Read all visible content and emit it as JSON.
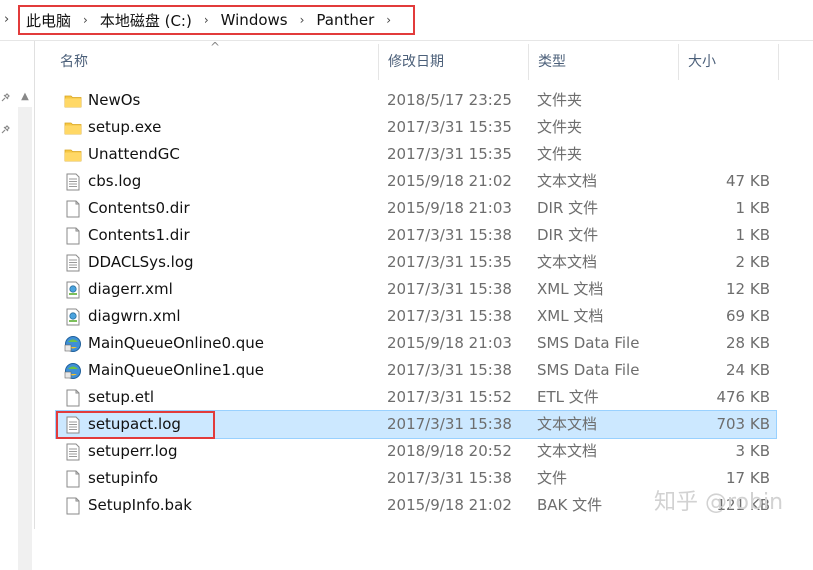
{
  "breadcrumb": {
    "items": [
      "此电脑",
      "本地磁盘 (C:)",
      "Windows",
      "Panther"
    ]
  },
  "columns": {
    "name": "名称",
    "date": "修改日期",
    "type": "类型",
    "size": "大小"
  },
  "files": [
    {
      "name": "NewOs",
      "date": "2018/5/17 23:25",
      "type": "文件夹",
      "size": "",
      "icon": "folder-icon"
    },
    {
      "name": "setup.exe",
      "date": "2017/3/31 15:35",
      "type": "文件夹",
      "size": "",
      "icon": "folder-icon"
    },
    {
      "name": "UnattendGC",
      "date": "2017/3/31 15:35",
      "type": "文件夹",
      "size": "",
      "icon": "folder-icon"
    },
    {
      "name": "cbs.log",
      "date": "2015/9/18 21:02",
      "type": "文本文档",
      "size": "47 KB",
      "icon": "text-file-icon"
    },
    {
      "name": "Contents0.dir",
      "date": "2015/9/18 21:03",
      "type": "DIR 文件",
      "size": "1 KB",
      "icon": "blank-file-icon"
    },
    {
      "name": "Contents1.dir",
      "date": "2017/3/31 15:38",
      "type": "DIR 文件",
      "size": "1 KB",
      "icon": "blank-file-icon"
    },
    {
      "name": "DDACLSys.log",
      "date": "2017/3/31 15:35",
      "type": "文本文档",
      "size": "2 KB",
      "icon": "text-file-icon"
    },
    {
      "name": "diagerr.xml",
      "date": "2017/3/31 15:38",
      "type": "XML 文档",
      "size": "12 KB",
      "icon": "xml-file-icon"
    },
    {
      "name": "diagwrn.xml",
      "date": "2017/3/31 15:38",
      "type": "XML 文档",
      "size": "69 KB",
      "icon": "xml-file-icon"
    },
    {
      "name": "MainQueueOnline0.que",
      "date": "2015/9/18 21:03",
      "type": "SMS Data File",
      "size": "28 KB",
      "icon": "sms-file-icon"
    },
    {
      "name": "MainQueueOnline1.que",
      "date": "2017/3/31 15:38",
      "type": "SMS Data File",
      "size": "24 KB",
      "icon": "sms-file-icon"
    },
    {
      "name": "setup.etl",
      "date": "2017/3/31 15:52",
      "type": "ETL 文件",
      "size": "476 KB",
      "icon": "blank-file-icon"
    },
    {
      "name": "setupact.log",
      "date": "2017/3/31 15:38",
      "type": "文本文档",
      "size": "703 KB",
      "icon": "text-file-icon"
    },
    {
      "name": "setuperr.log",
      "date": "2018/9/18 20:52",
      "type": "文本文档",
      "size": "3 KB",
      "icon": "text-file-icon"
    },
    {
      "name": "setupinfo",
      "date": "2017/3/31 15:38",
      "type": "文件",
      "size": "17 KB",
      "icon": "blank-file-icon"
    },
    {
      "name": "SetupInfo.bak",
      "date": "2015/9/18 21:02",
      "type": "BAK 文件",
      "size": "121 KB",
      "icon": "blank-file-icon"
    }
  ],
  "watermark": "知乎 @robin"
}
